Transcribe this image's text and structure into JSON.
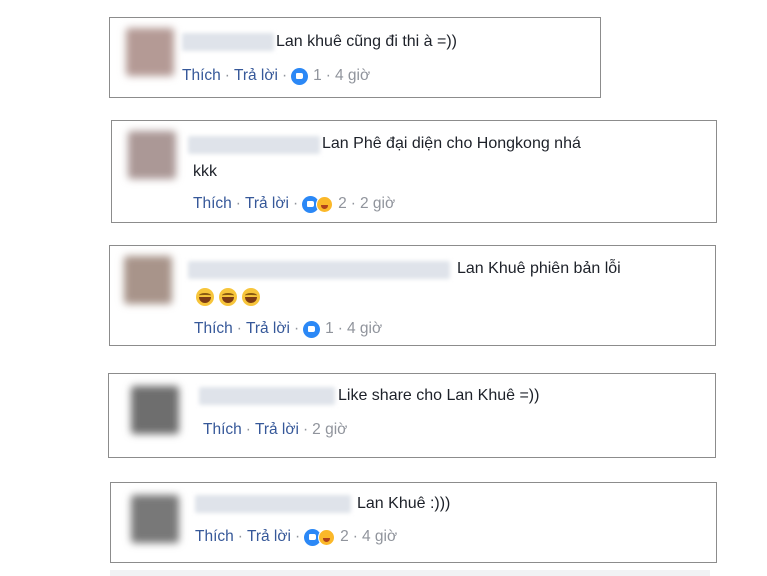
{
  "actions": {
    "like": "Thích",
    "reply": "Trả lời",
    "dot": "·"
  },
  "comments": [
    {
      "text": "Lan khuê cũng đi thi à =))",
      "reaction_count": "1",
      "time": "4 giờ"
    },
    {
      "text_line1": "Lan Phê đại diện cho Hongkong nhá",
      "text_line2": "kkk",
      "reaction_count": "2",
      "time": "2 giờ"
    },
    {
      "text": "Lan Khuê phiên bản lỗi",
      "emoji_count": 3,
      "reaction_count": "1",
      "time": "4 giờ"
    },
    {
      "text": "Like share cho Lan Khuê =))",
      "time": "2 giờ"
    },
    {
      "text": "Lan Khuê :)))",
      "reaction_count": "2",
      "time": "4 giờ"
    }
  ],
  "colors": {
    "link": "#365899",
    "meta": "#90949c",
    "border": "#8c8c8c",
    "like_blue": "#2b88f6",
    "haha_yellow": "#fbb829"
  }
}
